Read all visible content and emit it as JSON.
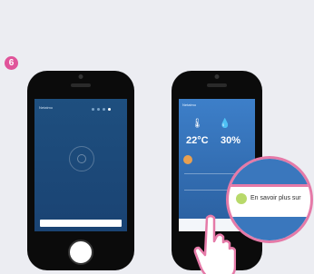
{
  "step": {
    "number": "6"
  },
  "phone1": {
    "brand": "Netatmo",
    "pager_dots": 4,
    "body_text": "",
    "primary_button": "",
    "secondary_link": ""
  },
  "phone2": {
    "brand": "Netatmo",
    "temperature": "22°C",
    "humidity": "30%",
    "bottom_bar": ""
  },
  "zoom": {
    "text": "En savoir plus sur"
  },
  "colors": {
    "step_badge": "#e0549a",
    "screen1_bg": "#1e4f7f",
    "screen2_bg": "#3d7fc9",
    "zoom_border": "#e57aa8"
  }
}
